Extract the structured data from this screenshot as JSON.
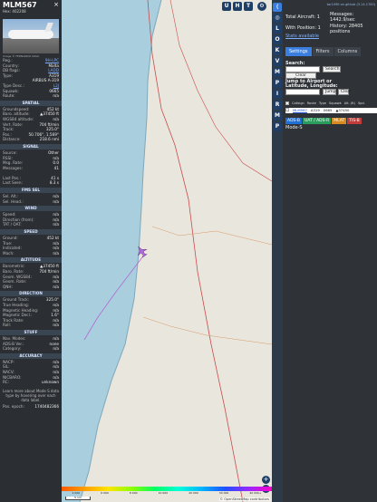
{
  "aircraft": {
    "callsign": "MLM567",
    "hex_label": "Hex:",
    "hex": "402208",
    "photo_credit": "Image © FERNANDO SILVA",
    "close_symbol": "×"
  },
  "info_rows": [
    {
      "k": "Reg.:",
      "v": "9H-LPC",
      "link": true
    },
    {
      "k": "Country:",
      "v": "Malta"
    },
    {
      "k": "DB flags:",
      "v": "LADD",
      "link": true
    },
    {
      "k": "Type:",
      "v": "A319"
    },
    {
      "k": "",
      "v": "AIRBUS A-319"
    },
    {
      "k": "Type Desc.:",
      "v": "L2J",
      "link": true
    },
    {
      "k": "Squawk:",
      "v": "0665"
    },
    {
      "k": "Route:",
      "v": "n/a"
    }
  ],
  "sections": {
    "spatial": {
      "title": "SPATIAL",
      "rows": [
        {
          "k": "Groundspeed:",
          "v": "452 kt"
        },
        {
          "k": "Baro. altitude:",
          "v": "▲37450 ft"
        },
        {
          "k": "WGS84 altitude:",
          "v": "n/a"
        },
        {
          "k": "Vert. Rate:",
          "v": "704 ft/min"
        },
        {
          "k": "Track:",
          "v": "325.0°"
        },
        {
          "k": "Pos.:",
          "v": "50.706°, 1.569°"
        },
        {
          "k": "Distance:",
          "v": "218.6 nmi"
        }
      ]
    },
    "signal": {
      "title": "SIGNAL",
      "rows": [
        {
          "k": "Source:",
          "v": "Other"
        },
        {
          "k": "RSSI:",
          "v": "n/a"
        },
        {
          "k": "Msg. Rate:",
          "v": "0.0"
        },
        {
          "k": "Messages:",
          "v": "41"
        },
        {
          "k": "",
          "v": ""
        },
        {
          "k": "Last Pos.:",
          "v": "41 s"
        },
        {
          "k": "Last Seen:",
          "v": "8.3 s"
        }
      ]
    },
    "fms": {
      "title": "FMS SEL",
      "rows": [
        {
          "k": "Sel. Alt.:",
          "v": "n/a"
        },
        {
          "k": "Sel. Head.:",
          "v": "n/a"
        }
      ]
    },
    "wind": {
      "title": "WIND",
      "rows": [
        {
          "k": "Speed:",
          "v": "n/a"
        },
        {
          "k": "Direction (from):",
          "v": "n/a"
        },
        {
          "k": "TAT / OAT:",
          "v": "n/a"
        }
      ]
    },
    "speed": {
      "title": "SPEED",
      "rows": [
        {
          "k": "Ground:",
          "v": "452 kt"
        },
        {
          "k": "True:",
          "v": "n/a"
        },
        {
          "k": "Indicated:",
          "v": "n/a"
        },
        {
          "k": "Mach:",
          "v": "n/a"
        }
      ]
    },
    "altitude": {
      "title": "ALTITUDE",
      "rows": [
        {
          "k": "Barometric:",
          "v": "▲37450 ft"
        },
        {
          "k": "Baro. Rate:",
          "v": "704 ft/min"
        },
        {
          "k": "Geom. WGS84:",
          "v": "n/a"
        },
        {
          "k": "Geom. Rate:",
          "v": "n/a"
        },
        {
          "k": "QNH:",
          "v": "n/a"
        }
      ]
    },
    "direction": {
      "title": "DIRECTION",
      "rows": [
        {
          "k": "Ground Track:",
          "v": "325.0°"
        },
        {
          "k": "True Heading:",
          "v": "n/a"
        },
        {
          "k": "Magnetic Heading:",
          "v": "n/a"
        },
        {
          "k": "Magnetic Decl.:",
          "v": "1.6°"
        },
        {
          "k": "Track Rate:",
          "v": "n/a"
        },
        {
          "k": "Roll:",
          "v": "n/a"
        }
      ]
    },
    "stuff": {
      "title": "STUFF",
      "rows": [
        {
          "k": "Nav. Modes:",
          "v": "n/a"
        },
        {
          "k": "ADS-B Ver.:",
          "v": "none"
        },
        {
          "k": "Category:",
          "v": "n/a"
        }
      ]
    },
    "accuracy": {
      "title": "ACCURACY",
      "rows": [
        {
          "k": "NACP:",
          "v": "n/a"
        },
        {
          "k": "SIL:",
          "v": "n/a"
        },
        {
          "k": "NACV:",
          "v": "n/a"
        },
        {
          "k": "NICBARO:",
          "v": "n/a"
        },
        {
          "k": "RC:",
          "v": "unknown"
        }
      ]
    }
  },
  "note": {
    "text": "Learn more about Mode S data type by hovering over each data label."
  },
  "footer_row": {
    "k": "Pos. epoch:",
    "v": "1740482366"
  },
  "map": {
    "top_buttons": [
      "U",
      "H",
      "T"
    ],
    "colorbar_labels": [
      "2 000",
      "6 000",
      "8 000",
      "10 000",
      "20 000",
      "30 000",
      "40 000+"
    ],
    "scale": "5 nm",
    "attribution": "© OpenStreetMap contributors",
    "zoom_in": "+",
    "zoom_out": "−",
    "land_color": "#e9e6dd",
    "sea_color": "#a9cfdf",
    "road_color": "#c94c4c",
    "aircraft_color": "#b06ad6"
  },
  "toolbar": {
    "buttons": [
      "⟨",
      "◎",
      "L",
      "O",
      "K",
      "V",
      "M",
      "P",
      "I",
      "R",
      "M",
      "P"
    ]
  },
  "right": {
    "version": "tar1090 on github (3.14.1700)",
    "stats": {
      "total": "Total Aircraft: 1",
      "with_pos": "With Position: 1",
      "stats_label": "Stats available",
      "messages_label": "Messages:",
      "messages_value": "1442.9/sec",
      "history_label": "History: 28405",
      "history_value": "positions"
    },
    "tabs": [
      "Settings",
      "Filters",
      "Columns"
    ],
    "search_label": "Search:",
    "search_button": "Search",
    "clear_button": "Clear Search",
    "jump_label": "Jump to Airport or Latitude, Longitude:",
    "jump_button": "Jump",
    "clear_small": "Clear",
    "table_headers": [
      "Callsign",
      "Route",
      "Type",
      "Squawk",
      "Alt. (ft)",
      "Spd."
    ],
    "table_row": {
      "callsign": "MLM567",
      "type": "A319",
      "squawk": "0665",
      "alt": "▲37450"
    },
    "chips": [
      {
        "label": "ADS-B",
        "color": "#1f6fd6"
      },
      {
        "label": "UAT / ADS-R",
        "color": "#2a9d5c"
      },
      {
        "label": "MLAT",
        "color": "#d68a1f"
      },
      {
        "label": "TIS-B",
        "color": "#c23b3b"
      }
    ],
    "modes_label": "Mode-S"
  }
}
